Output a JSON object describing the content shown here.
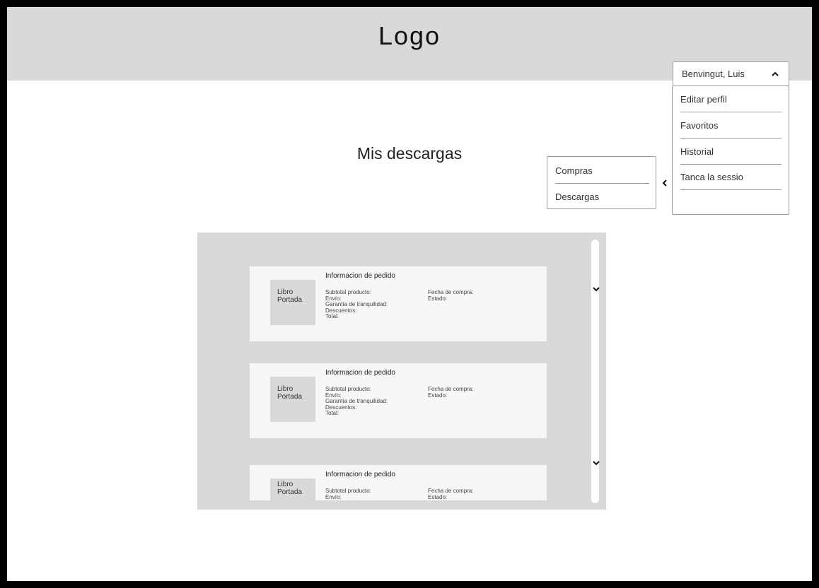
{
  "header": {
    "logo": "Logo"
  },
  "user_menu": {
    "name": "Benvingut, Luis",
    "items": [
      {
        "label": "Editar perfil"
      },
      {
        "label": "Favoritos"
      },
      {
        "label": "Historial"
      },
      {
        "label": "Tanca la sessio"
      }
    ]
  },
  "page": {
    "title": "Mis descargas"
  },
  "submenu": {
    "items": [
      {
        "label": "Compras"
      },
      {
        "label": "Descargas"
      }
    ]
  },
  "orders": [
    {
      "title": "Informacion de pedido",
      "cover": [
        "Libro",
        "Portada"
      ],
      "fields": [
        "Subtotal producto:",
        "Envío:",
        "Garantía de tranquilidad:",
        "Descuentos:",
        "Total:"
      ],
      "right": [
        "Fecha de compra:",
        "Estado:"
      ]
    },
    {
      "title": "Informacion de pedido",
      "cover": [
        "Libro",
        "Portada"
      ],
      "fields": [
        "Subtotal producto:",
        "Envío:",
        "Garantía de tranquilidad:",
        "Descuentos:",
        "Total:"
      ],
      "right": [
        "Fecha de compra:",
        "Estado:"
      ]
    },
    {
      "title": "Informacion de pedido",
      "cover": [
        "Libro",
        "Portada"
      ],
      "fields": [
        "Subtotal producto:",
        "Envío:"
      ],
      "right": [
        "Fecha de compra:",
        "Estado:"
      ]
    }
  ],
  "icons": {
    "user_menu_toggle": "chevron-up-icon",
    "submenu_back": "chevron-left-icon",
    "expand": "chevron-down-icon"
  }
}
